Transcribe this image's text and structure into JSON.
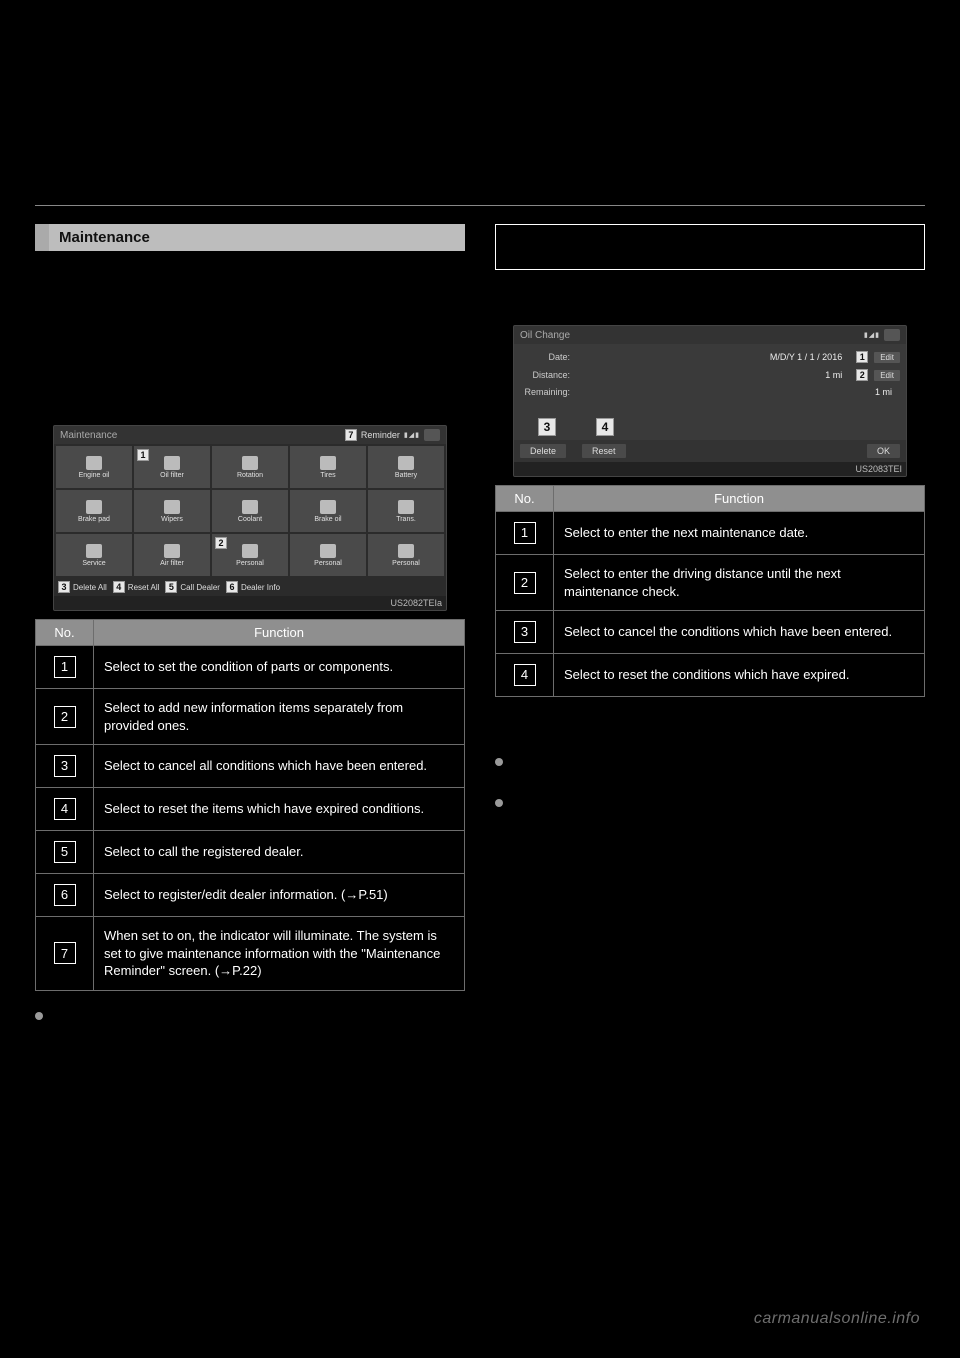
{
  "left": {
    "sectionTitle": "Maintenance",
    "screenshot": {
      "title": "Maintenance",
      "reminderMarker": "7",
      "reminderLabel": "Reminder",
      "grid": [
        "Engine oil",
        "Oil filter",
        "Rotation",
        "Tires",
        "Battery",
        "Brake pad",
        "Wipers",
        "Coolant",
        "Brake oil",
        "Trans.",
        "Service",
        "Air filter",
        "Personal",
        "Personal",
        "Personal"
      ],
      "row2markers": {
        "m1": "1",
        "m2": "2"
      },
      "footer": {
        "m3": "3",
        "l3": "Delete All",
        "m4": "4",
        "l4": "Reset All",
        "m5": "5",
        "l5": "Call Dealer",
        "m6": "6",
        "l6": "Dealer Info"
      },
      "code": "US2082TEIa"
    },
    "table": {
      "h1": "No.",
      "h2": "Function",
      "rows": [
        {
          "n": "1",
          "f": "Select to set the condition of parts or components."
        },
        {
          "n": "2",
          "f": "Select to add new information items separately from provided ones."
        },
        {
          "n": "3",
          "f": "Select to cancel all conditions which have been entered."
        },
        {
          "n": "4",
          "f": "Select to reset the items which have expired conditions."
        },
        {
          "n": "5",
          "f": "Select to call the registered dealer."
        },
        {
          "n": "6",
          "f": "Select to register/edit dealer information. (→P.51)"
        },
        {
          "n": "7",
          "f": "When set to on, the indicator will illuminate. The system is set to give maintenance information with the \"Maintenance Reminder\" screen. (→P.22)"
        }
      ]
    }
  },
  "right": {
    "screenshot": {
      "title": "Oil Change",
      "rows": [
        {
          "lbl": "Date:",
          "val": "M/D/Y    1  / 1  / 2016",
          "marker": "1",
          "btn": "Edit"
        },
        {
          "lbl": "Distance:",
          "val": "1 mi",
          "marker": "2",
          "btn": "Edit"
        },
        {
          "lbl": "Remaining:",
          "val": "1 mi",
          "marker": "",
          "btn": ""
        }
      ],
      "footerMarkers": {
        "m3": "3",
        "m4": "4"
      },
      "footer": {
        "del": "Delete",
        "reset": "Reset",
        "ok": "OK"
      },
      "code": "US2083TEI"
    },
    "table": {
      "h1": "No.",
      "h2": "Function",
      "rows": [
        {
          "n": "1",
          "f": "Select to enter the next maintenance date."
        },
        {
          "n": "2",
          "f": "Select to enter the driving distance until the next maintenance check."
        },
        {
          "n": "3",
          "f": "Select to cancel the conditions which have been entered."
        },
        {
          "n": "4",
          "f": "Select to reset the conditions which have expired."
        }
      ]
    }
  },
  "footerBrand": "carmanualsonline.info"
}
